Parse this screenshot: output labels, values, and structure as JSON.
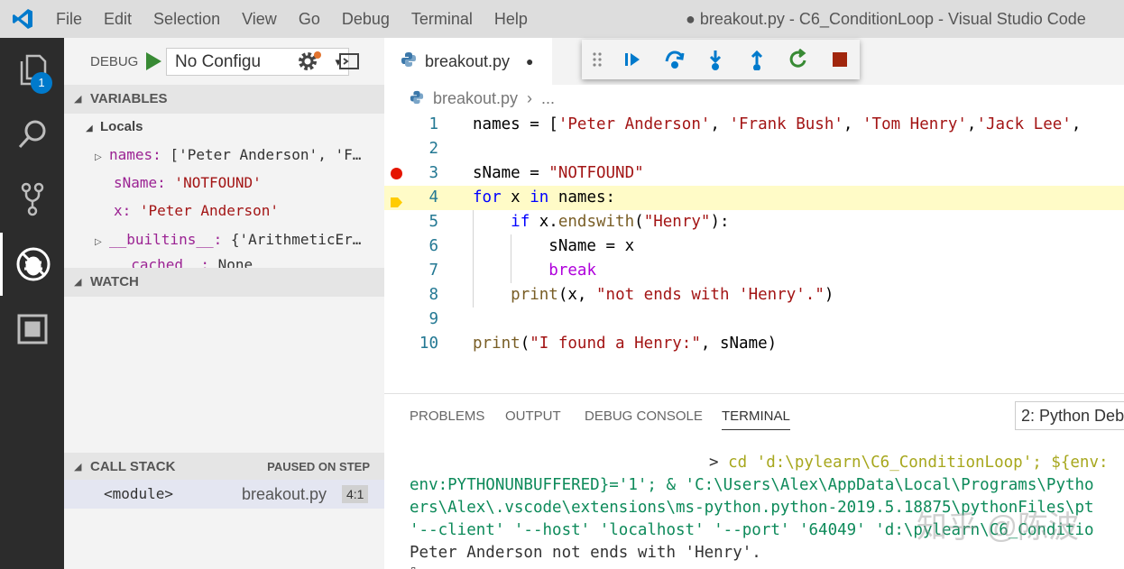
{
  "menu": [
    "File",
    "Edit",
    "Selection",
    "View",
    "Go",
    "Debug",
    "Terminal",
    "Help"
  ],
  "window_title": "● breakout.py - C6_ConditionLoop - Visual Studio Code",
  "activity": {
    "explorer_badge": "1"
  },
  "debug": {
    "label": "DEBUG",
    "config": "No Configu",
    "caret": "▾"
  },
  "variables": {
    "header": "VARIABLES",
    "locals_label": "Locals",
    "items": [
      {
        "name": "names:",
        "value": " ['Peter Anderson', 'F…"
      },
      {
        "name": "sName:",
        "value": " 'NOTFOUND'"
      },
      {
        "name": "x:",
        "value": " 'Peter Anderson'"
      },
      {
        "name": "__builtins__:",
        "value": " {'ArithmeticEr…"
      },
      {
        "name": "__cached__:",
        "value": " None"
      }
    ]
  },
  "watch": {
    "header": "WATCH"
  },
  "callstack": {
    "header": "CALL STACK",
    "status": "PAUSED ON STEP",
    "frame": "<module>",
    "file": "breakout.py",
    "position": "4:1"
  },
  "editor": {
    "tab_label": "breakout.py",
    "dirty_dot": "●",
    "breadcrumb_file": "breakout.py",
    "breadcrumb_sep": "›",
    "breadcrumb_more": "...",
    "current_line": 4,
    "breakpoint_line": 3,
    "lines": [
      "names = ['Peter Anderson', 'Frank Bush', 'Tom Henry','Jack Lee',",
      "",
      "sName = \"NOTFOUND\"",
      "for x in names:",
      "    if x.endswith(\"Henry\"):",
      "        sName = x",
      "        break",
      "    print(x, \"not ends with 'Henry'.\")",
      "",
      "print(\"I found a Henry:\", sName)"
    ]
  },
  "panel": {
    "tabs": [
      "PROBLEMS",
      "OUTPUT",
      "DEBUG CONSOLE",
      "TERMINAL"
    ],
    "active_tab": "TERMINAL",
    "terminal_select": "2: Python Deb",
    "terminal": {
      "prompt": "> ",
      "cmd": "cd 'd:\\pylearn\\C6_ConditionLoop'; ${env:",
      "line2": "env:PYTHONUNBUFFERED}='1'; & 'C:\\Users\\Alex\\AppData\\Local\\Programs\\Pytho",
      "line3": "ers\\Alex\\.vscode\\extensions\\ms-python.python-2019.5.18875\\pythonFiles\\pt",
      "line4": "'--client' '--host' 'localhost' '--port' '64049' 'd:\\pylearn\\C6_Conditio",
      "output": "Peter Anderson not ends with 'Henry'.",
      "cursor": "▯"
    }
  },
  "watermark": "知乎 @陈波",
  "colors": {
    "accent": "#007acc",
    "current_line": "#fffbc7",
    "breakpoint": "#e51400",
    "stop": "#a1260d",
    "continue": "#007acc",
    "restart": "#388a34"
  }
}
